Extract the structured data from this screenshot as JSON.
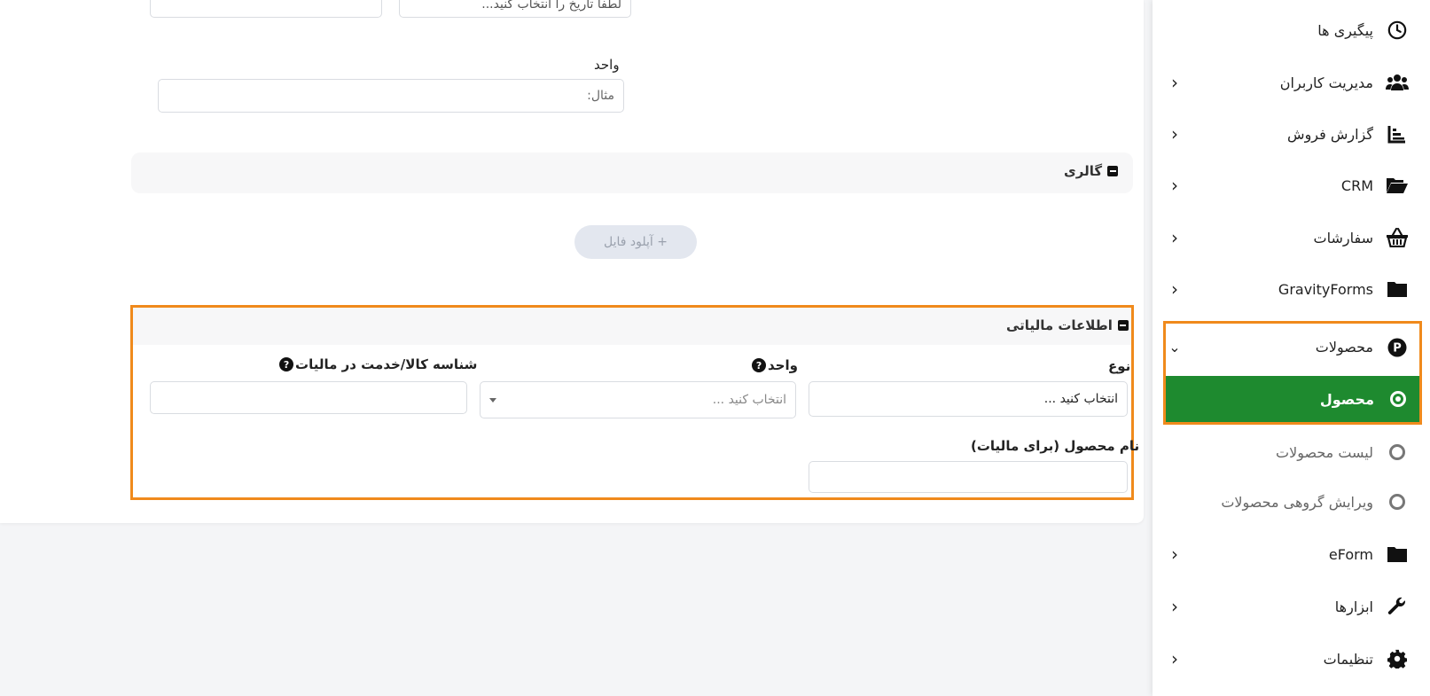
{
  "form": {
    "date_placeholder": "لطفا تاریخ را انتخاب کنید...",
    "unit_label": "واحد",
    "unit_placeholder": "مثال:",
    "gallery_title": "گالری",
    "upload_button": "+ آپلود فایل"
  },
  "tax": {
    "title": "اطلاعات مالیاتی",
    "type_label": "نوع",
    "type_value": "انتخاب کنید ...",
    "unit_label": "واحد",
    "unit_placeholder": "انتخاب کنید ...",
    "id_label": "شناسه کالا/خدمت در مالیات",
    "name_label": "نام محصول (برای مالیات)"
  },
  "sidebar": {
    "items": [
      {
        "label": "پیگیری ها",
        "icon": "clock-icon"
      },
      {
        "label": "مدیریت کاربران",
        "icon": "users-icon"
      },
      {
        "label": "گزارش فروش",
        "icon": "chart-icon"
      },
      {
        "label": "CRM",
        "icon": "folder-open-icon"
      },
      {
        "label": "سفارشات",
        "icon": "basket-icon"
      },
      {
        "label": "GravityForms",
        "icon": "folder-icon"
      },
      {
        "label": "محصولات",
        "icon": "product-icon"
      },
      {
        "label": "محصول",
        "icon": "circle-icon"
      },
      {
        "label": "لیست محصولات",
        "icon": "circle-icon"
      },
      {
        "label": "ویرایش گروهی محصولات",
        "icon": "circle-icon"
      },
      {
        "label": "eForm",
        "icon": "folder-icon"
      },
      {
        "label": "ابزارها",
        "icon": "wrench-icon"
      },
      {
        "label": "تنظیمات",
        "icon": "gear-icon"
      }
    ]
  },
  "colors": {
    "highlight": "#f08a1c",
    "active": "#1e8a2f"
  }
}
